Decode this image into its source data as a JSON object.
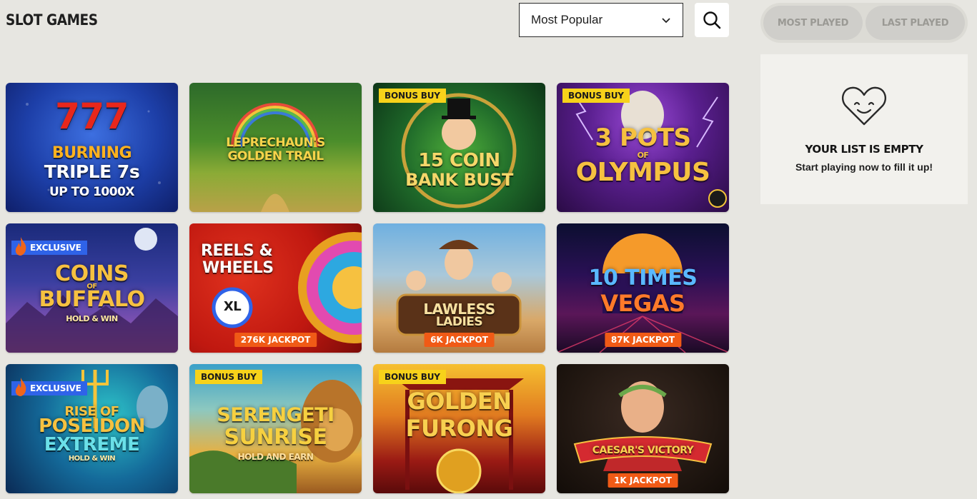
{
  "header": {
    "title": "SLOT GAMES",
    "sort": {
      "selected": "Most Popular"
    }
  },
  "sidebar": {
    "tabs": [
      {
        "label": "MOST PLAYED"
      },
      {
        "label": "LAST PLAYED"
      }
    ],
    "empty": {
      "title": "YOUR LIST IS EMPTY",
      "subtitle": "Start playing now to fill it up!"
    }
  },
  "games": [
    {
      "name": "Burning Triple 7s",
      "logo": [
        "777",
        "BURNING",
        "TRIPLE 7s",
        "UP TO 1000X"
      ],
      "badge": "",
      "jackpot": ""
    },
    {
      "name": "Leprechaun's Golden Trail",
      "logo": [
        "LEPRECHAUN'S",
        "GOLDEN TRAIL"
      ],
      "badge": "",
      "jackpot": ""
    },
    {
      "name": "15 Coin Bank Bust",
      "logo": [
        "15 COIN",
        "BANK BUST"
      ],
      "badge": "BONUS BUY",
      "jackpot": ""
    },
    {
      "name": "3 Pots of Olympus",
      "logo": [
        "3 POTS",
        "OF",
        "OLYMPUS"
      ],
      "badge": "BONUS BUY",
      "jackpot": ""
    },
    {
      "name": "Coins of Buffalo",
      "logo": [
        "COINS",
        "OF",
        "BUFFALO",
        "HOLD & WIN"
      ],
      "badge": "EXCLUSIVE",
      "jackpot": ""
    },
    {
      "name": "Reels & Wheels XL",
      "logo": [
        "REELS &",
        "WHEELS",
        "XL"
      ],
      "badge": "",
      "jackpot": "276K JACKPOT"
    },
    {
      "name": "Lawless Ladies",
      "logo": [
        "LAWLESS",
        "LADIES"
      ],
      "badge": "",
      "jackpot": "6K JACKPOT"
    },
    {
      "name": "10 Times Vegas",
      "logo": [
        "10 TIMES",
        "VEGAS"
      ],
      "badge": "",
      "jackpot": "87K JACKPOT"
    },
    {
      "name": "Rise of Poseidon Extreme",
      "logo": [
        "RISE OF",
        "POSEIDON",
        "EXTREME",
        "HOLD & WIN"
      ],
      "badge": "EXCLUSIVE",
      "jackpot": ""
    },
    {
      "name": "Serengeti Sunrise",
      "logo": [
        "SERENGETI",
        "SUNRISE",
        "HOLD AND EARN"
      ],
      "badge": "BONUS BUY",
      "jackpot": ""
    },
    {
      "name": "Golden Furong",
      "logo": [
        "GOLDEN",
        "FURONG"
      ],
      "badge": "BONUS BUY",
      "jackpot": ""
    },
    {
      "name": "Caesar's Victory",
      "logo": [
        "CAESAR'S VICTORY"
      ],
      "badge": "",
      "jackpot": "1K JACKPOT"
    }
  ],
  "colors": {
    "background": "#e7e6e1",
    "bonus_badge": "#f7d21a",
    "exclusive_badge": "#2f63e8",
    "jackpot_badge": "#f05a16"
  },
  "icons": {
    "search": "search-icon",
    "sort": "chevron-down-icon",
    "empty": "smiling-heart-icon",
    "exclusive": "flame-icon"
  }
}
